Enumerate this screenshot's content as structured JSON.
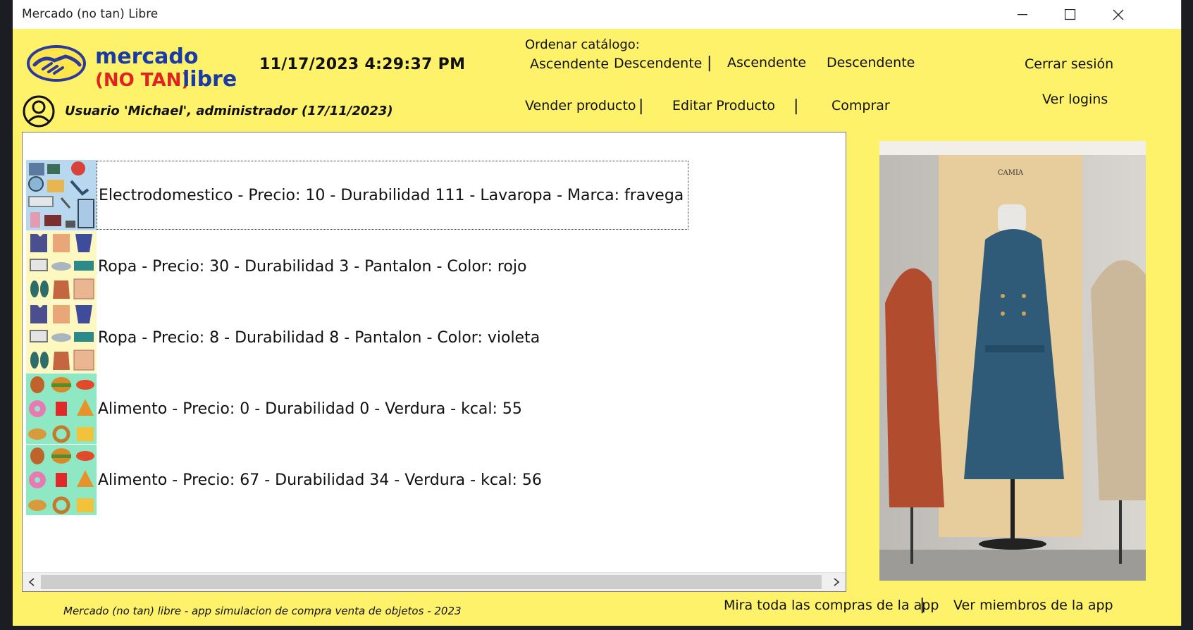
{
  "window": {
    "title": "Mercado (no tan) Libre"
  },
  "logo": {
    "line1": "mercado",
    "line2a": "(NO TAN)",
    "line2b": "libre"
  },
  "header": {
    "datetime": "11/17/2023 4:29:37 PM",
    "sort_label": "Ordenar catálogo:",
    "sort": [
      "Ascendente",
      "Descendente",
      "Ascendente",
      "Descendente"
    ],
    "sep": "|",
    "logout": "Cerrar sesión",
    "view_logins": "Ver logins"
  },
  "user": {
    "label": "Usuario 'Michael', administrador (17/11/2023)"
  },
  "actions": {
    "sell": "Vender producto",
    "edit": "Editar Producto",
    "buy": "Comprar"
  },
  "products": [
    {
      "category": "Electrodomestico",
      "icon": "appliances-icon",
      "text": "Electrodomestico - Precio: 10 - Durabilidad 111 - Lavaropa - Marca: fravega",
      "selected": true
    },
    {
      "category": "Ropa",
      "icon": "clothes-icon",
      "text": "Ropa - Precio: 30 - Durabilidad 3 - Pantalon - Color: rojo",
      "selected": false
    },
    {
      "category": "Ropa",
      "icon": "clothes-icon",
      "text": "Ropa - Precio: 8 - Durabilidad 8 - Pantalon - Color: violeta",
      "selected": false
    },
    {
      "category": "Alimento",
      "icon": "food-icon",
      "text": "Alimento - Precio: 0 - Durabilidad 0 - Verdura - kcal: 55",
      "selected": false
    },
    {
      "category": "Alimento",
      "icon": "food-icon",
      "text": "Alimento - Precio: 67 - Durabilidad 34 - Verdura - kcal: 56",
      "selected": false
    }
  ],
  "poster": {
    "brand": "CAMIA"
  },
  "footer": {
    "credit": "Mercado (no tan) libre - app simulacion de compra venta de objetos - 2023",
    "all_purchases": "Mira toda las compras de la app",
    "members": "Ver miembros de la app"
  },
  "colors": {
    "background": "#fdf26a",
    "accent": "#1a3aa8",
    "logo_red": "#e0231e"
  }
}
